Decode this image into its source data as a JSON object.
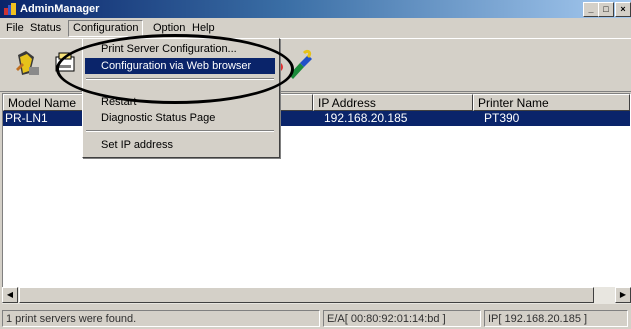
{
  "window": {
    "title": "AdminManager",
    "controls": {
      "minimize": "_",
      "maximize": "□",
      "close": "×"
    }
  },
  "menubar": {
    "items": [
      "File",
      "Status",
      "Configuration",
      "Option",
      "Help"
    ]
  },
  "toolbar": {
    "icons": [
      "search-printer-icon",
      "printer-properties-icon",
      "refresh-icon",
      "ip-address-icon"
    ]
  },
  "dropdown": {
    "items": [
      "Print Server Configuration...",
      "Configuration via Web browser",
      "Restart",
      "Diagnostic Status Page",
      "Set IP address"
    ],
    "highlighted_index": 1
  },
  "list": {
    "columns": [
      "Model Name",
      "IP Address",
      "Printer Name"
    ],
    "rows": [
      {
        "model": "PR-LN1",
        "ip": "192.168.20.185",
        "printer": "PT390"
      }
    ]
  },
  "statusbar": {
    "message": "1 print servers were found.",
    "ea": "E/A[ 00:80:92:01:14:bd ]",
    "ip": "IP[ 192.168.20.185 ]"
  },
  "colors": {
    "selection": "#0a246a",
    "face": "#d4d0c8",
    "highlight_oval": "#000000"
  }
}
